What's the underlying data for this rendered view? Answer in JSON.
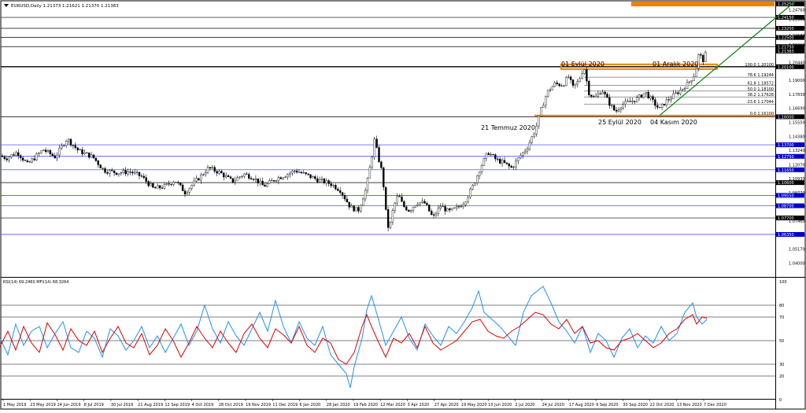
{
  "header": {
    "symbol_line": "EURUSD,Daily  1.21373 1.21621 1.21370 1.21383"
  },
  "indicator": {
    "title": "RSI(14) 69.2460  MFI(14) 68.3264"
  },
  "colors": {
    "rsi_line": "#e00000",
    "mfi_line": "#1e90ff",
    "trendline": "#008000",
    "zone": "#f08000",
    "blue_level": "#3030ff",
    "black_level": "#000000",
    "label_box_black": "#000000",
    "label_box_blue": "#0000cc"
  },
  "chart_data": {
    "type": "candlestick",
    "symbol": "EURUSD",
    "timeframe": "Daily",
    "ohlc_readout": {
      "open": 1.21373,
      "high": 1.21621,
      "low": 1.2137,
      "close": 1.21383
    },
    "x_ticks": [
      "1 May 2019",
      "23 May 2019",
      "14 Jun 2019",
      "8 Jul 2019",
      "30 Jul 2019",
      "21 Aug 2019",
      "12 Sep 2019",
      "4 Oct 2019",
      "28 Oct 2019",
      "19 Nov 2019",
      "11 Dec 2019",
      "6 Jan 2020",
      "28 Jan 2020",
      "19 Feb 2020",
      "12 Mar 2020",
      "3 Apr 2020",
      "27 Apr 2020",
      "19 May 2020",
      "10 Jun 2020",
      "2 Jul 2020",
      "24 Jul 2020",
      "17 Aug 2020",
      "9 Sep 2020",
      "30 Sep 2020",
      "22 Oct 2020",
      "13 Nov 2020",
      "7 Dec 2020"
    ],
    "y_axis_labels": [
      "1.24760",
      "1.23980",
      "1.23290",
      "1.22680",
      "1.21910",
      "1.20440",
      "1.19000",
      "1.17830",
      "1.16690",
      "1.15550",
      "1.14380",
      "1.13240",
      "1.12070",
      "1.10930",
      "1.09770",
      "1.08630",
      "1.07460",
      "1.06320",
      "1.05170",
      "1.04000",
      "1.02860"
    ],
    "price_path": [
      [
        0,
        1.128
      ],
      [
        8,
        1.126
      ],
      [
        22,
        1.131
      ],
      [
        35,
        1.121
      ],
      [
        55,
        1.133
      ],
      [
        70,
        1.127
      ],
      [
        85,
        1.142
      ],
      [
        100,
        1.132
      ],
      [
        118,
        1.127
      ],
      [
        132,
        1.116
      ],
      [
        150,
        1.114
      ],
      [
        165,
        1.115
      ],
      [
        180,
        1.111
      ],
      [
        195,
        1.101
      ],
      [
        210,
        1.103
      ],
      [
        222,
        1.108
      ],
      [
        235,
        1.098
      ],
      [
        250,
        1.108
      ],
      [
        265,
        1.118
      ],
      [
        280,
        1.114
      ],
      [
        295,
        1.107
      ],
      [
        310,
        1.113
      ],
      [
        322,
        1.11
      ],
      [
        335,
        1.103
      ],
      [
        350,
        1.109
      ],
      [
        362,
        1.112
      ],
      [
        375,
        1.116
      ],
      [
        390,
        1.112
      ],
      [
        405,
        1.108
      ],
      [
        420,
        1.105
      ],
      [
        432,
        1.1
      ],
      [
        445,
        1.086
      ],
      [
        455,
        1.083
      ],
      [
        465,
        1.101
      ],
      [
        472,
        1.125
      ],
      [
        476,
        1.142
      ],
      [
        480,
        1.128
      ],
      [
        486,
        1.113
      ],
      [
        490,
        1.083
      ],
      [
        494,
        1.066
      ],
      [
        500,
        1.086
      ],
      [
        506,
        1.096
      ],
      [
        512,
        1.087
      ],
      [
        520,
        1.083
      ],
      [
        530,
        1.09
      ],
      [
        540,
        1.089
      ],
      [
        550,
        1.077
      ],
      [
        560,
        1.087
      ],
      [
        570,
        1.082
      ],
      [
        580,
        1.085
      ],
      [
        590,
        1.09
      ],
      [
        600,
        1.102
      ],
      [
        610,
        1.118
      ],
      [
        620,
        1.131
      ],
      [
        630,
        1.125
      ],
      [
        640,
        1.122
      ],
      [
        650,
        1.118
      ],
      [
        660,
        1.127
      ],
      [
        670,
        1.135
      ],
      [
        680,
        1.149
      ],
      [
        688,
        1.167
      ],
      [
        695,
        1.18
      ],
      [
        705,
        1.187
      ],
      [
        715,
        1.186
      ],
      [
        722,
        1.193
      ],
      [
        728,
        1.184
      ],
      [
        735,
        1.189
      ],
      [
        742,
        1.201
      ],
      [
        748,
        1.18
      ],
      [
        755,
        1.175
      ],
      [
        765,
        1.182
      ],
      [
        775,
        1.17
      ],
      [
        782,
        1.164
      ],
      [
        790,
        1.17
      ],
      [
        800,
        1.172
      ],
      [
        810,
        1.175
      ],
      [
        820,
        1.18
      ],
      [
        830,
        1.172
      ],
      [
        838,
        1.166
      ],
      [
        845,
        1.172
      ],
      [
        855,
        1.177
      ],
      [
        865,
        1.182
      ],
      [
        875,
        1.188
      ],
      [
        883,
        1.195
      ],
      [
        888,
        1.212
      ],
      [
        893,
        1.206
      ],
      [
        898,
        1.214
      ]
    ],
    "horizontal_levels": [
      {
        "label": "1.25250",
        "price": 1.2525,
        "style": "zone"
      },
      {
        "label": "1.24150",
        "price": 1.2415,
        "style": "black"
      },
      {
        "label": "1.23250",
        "price": 1.2325,
        "style": "black"
      },
      {
        "label": "1.22500",
        "price": 1.225,
        "style": "black"
      },
      {
        "label": "1.21750",
        "price": 1.2175,
        "style": "black"
      },
      {
        "label": "1.20100",
        "price": 1.201,
        "style": "black_thick"
      },
      {
        "label": "1.16000",
        "price": 1.16,
        "style": "black"
      },
      {
        "label": "1.13700",
        "price": 1.137,
        "style": "blue"
      },
      {
        "label": "1.12750",
        "price": 1.1275,
        "style": "blue"
      },
      {
        "label": "1.11650",
        "price": 1.1165,
        "style": "blue"
      },
      {
        "label": "1.10600",
        "price": 1.106,
        "style": "black"
      },
      {
        "label": "1.09550",
        "price": 1.0955,
        "style": "blue"
      },
      {
        "label": "1.08700",
        "price": 1.087,
        "style": "blue"
      },
      {
        "label": "1.07700",
        "price": 1.077,
        "style": "black"
      },
      {
        "label": "1.06350",
        "price": 1.0635,
        "style": "blue"
      }
    ],
    "last_price_label": "1.21383",
    "fibonacci": {
      "high_price": 1.201,
      "low_price": 1.161,
      "levels": [
        {
          "label": "100.0 1.20100",
          "ratio": 1.0
        },
        {
          "label": "78.6 1.19244",
          "ratio": 0.786
        },
        {
          "label": "61.8 1.18572",
          "ratio": 0.618
        },
        {
          "label": "50.0 1.18100",
          "ratio": 0.5
        },
        {
          "label": "38.2 1.17628",
          "ratio": 0.382
        },
        {
          "label": "23.6 1.17044",
          "ratio": 0.236
        },
        {
          "label": "0.0 1.16100",
          "ratio": 0.0
        }
      ]
    },
    "annotations": [
      {
        "text": "01 Eylül 2020"
      },
      {
        "text": "01 Aralık 2020"
      },
      {
        "text": "21 Temmuz 2020"
      },
      {
        "text": "25 Eylül 2020"
      },
      {
        "text": "04 Kasım 2020"
      }
    ],
    "indicator": {
      "rsi_period": 14,
      "rsi_value": 69.246,
      "mfi_period": 14,
      "mfi_value": 68.3264,
      "scale_labels": [
        "100",
        "80",
        "70",
        "50",
        "30",
        "20",
        "0"
      ],
      "levels": [
        80,
        70,
        50,
        30,
        20
      ],
      "rsi_path": [
        [
          0,
          45
        ],
        [
          10,
          58
        ],
        [
          20,
          42
        ],
        [
          30,
          62
        ],
        [
          40,
          48
        ],
        [
          50,
          40
        ],
        [
          60,
          65
        ],
        [
          70,
          55
        ],
        [
          80,
          42
        ],
        [
          90,
          60
        ],
        [
          100,
          50
        ],
        [
          110,
          46
        ],
        [
          120,
          58
        ],
        [
          130,
          40
        ],
        [
          140,
          52
        ],
        [
          150,
          62
        ],
        [
          160,
          48
        ],
        [
          170,
          44
        ],
        [
          180,
          56
        ],
        [
          190,
          38
        ],
        [
          200,
          46
        ],
        [
          210,
          60
        ],
        [
          220,
          50
        ],
        [
          230,
          36
        ],
        [
          240,
          48
        ],
        [
          250,
          62
        ],
        [
          260,
          52
        ],
        [
          270,
          44
        ],
        [
          280,
          58
        ],
        [
          290,
          48
        ],
        [
          300,
          40
        ],
        [
          310,
          56
        ],
        [
          320,
          64
        ],
        [
          330,
          52
        ],
        [
          340,
          44
        ],
        [
          350,
          60
        ],
        [
          360,
          55
        ],
        [
          370,
          48
        ],
        [
          380,
          62
        ],
        [
          390,
          46
        ],
        [
          400,
          40
        ],
        [
          410,
          52
        ],
        [
          420,
          48
        ],
        [
          430,
          34
        ],
        [
          440,
          30
        ],
        [
          450,
          40
        ],
        [
          460,
          62
        ],
        [
          466,
          72
        ],
        [
          472,
          62
        ],
        [
          480,
          50
        ],
        [
          490,
          36
        ],
        [
          500,
          52
        ],
        [
          510,
          48
        ],
        [
          520,
          56
        ],
        [
          530,
          44
        ],
        [
          540,
          62
        ],
        [
          550,
          48
        ],
        [
          560,
          42
        ],
        [
          570,
          46
        ],
        [
          580,
          50
        ],
        [
          590,
          58
        ],
        [
          600,
          66
        ],
        [
          610,
          68
        ],
        [
          620,
          58
        ],
        [
          630,
          54
        ],
        [
          640,
          52
        ],
        [
          650,
          58
        ],
        [
          660,
          62
        ],
        [
          670,
          68
        ],
        [
          680,
          74
        ],
        [
          690,
          72
        ],
        [
          700,
          64
        ],
        [
          710,
          60
        ],
        [
          720,
          68
        ],
        [
          730,
          56
        ],
        [
          740,
          62
        ],
        [
          750,
          48
        ],
        [
          760,
          50
        ],
        [
          770,
          44
        ],
        [
          780,
          42
        ],
        [
          790,
          50
        ],
        [
          800,
          52
        ],
        [
          810,
          56
        ],
        [
          820,
          50
        ],
        [
          830,
          44
        ],
        [
          840,
          48
        ],
        [
          850,
          56
        ],
        [
          860,
          60
        ],
        [
          870,
          68
        ],
        [
          880,
          72
        ],
        [
          885,
          64
        ],
        [
          892,
          70
        ],
        [
          898,
          69
        ]
      ],
      "mfi_path": [
        [
          0,
          52
        ],
        [
          10,
          38
        ],
        [
          20,
          64
        ],
        [
          30,
          46
        ],
        [
          40,
          58
        ],
        [
          50,
          62
        ],
        [
          60,
          44
        ],
        [
          70,
          56
        ],
        [
          80,
          66
        ],
        [
          90,
          44
        ],
        [
          100,
          40
        ],
        [
          110,
          58
        ],
        [
          120,
          52
        ],
        [
          130,
          36
        ],
        [
          140,
          60
        ],
        [
          150,
          54
        ],
        [
          160,
          42
        ],
        [
          170,
          50
        ],
        [
          180,
          62
        ],
        [
          190,
          44
        ],
        [
          200,
          54
        ],
        [
          210,
          40
        ],
        [
          220,
          52
        ],
        [
          230,
          64
        ],
        [
          240,
          46
        ],
        [
          250,
          58
        ],
        [
          260,
          80
        ],
        [
          270,
          60
        ],
        [
          280,
          48
        ],
        [
          290,
          66
        ],
        [
          300,
          54
        ],
        [
          310,
          46
        ],
        [
          320,
          60
        ],
        [
          330,
          74
        ],
        [
          340,
          58
        ],
        [
          350,
          84
        ],
        [
          360,
          62
        ],
        [
          370,
          48
        ],
        [
          380,
          66
        ],
        [
          390,
          52
        ],
        [
          400,
          46
        ],
        [
          410,
          62
        ],
        [
          420,
          38
        ],
        [
          430,
          30
        ],
        [
          440,
          22
        ],
        [
          445,
          10
        ],
        [
          450,
          28
        ],
        [
          460,
          52
        ],
        [
          466,
          76
        ],
        [
          472,
          88
        ],
        [
          480,
          70
        ],
        [
          490,
          46
        ],
        [
          500,
          58
        ],
        [
          510,
          70
        ],
        [
          520,
          52
        ],
        [
          530,
          42
        ],
        [
          540,
          64
        ],
        [
          550,
          54
        ],
        [
          560,
          46
        ],
        [
          570,
          62
        ],
        [
          580,
          56
        ],
        [
          590,
          66
        ],
        [
          600,
          78
        ],
        [
          608,
          92
        ],
        [
          615,
          74
        ],
        [
          625,
          68
        ],
        [
          635,
          62
        ],
        [
          645,
          54
        ],
        [
          655,
          46
        ],
        [
          665,
          74
        ],
        [
          675,
          88
        ],
        [
          690,
          96
        ],
        [
          700,
          82
        ],
        [
          710,
          66
        ],
        [
          720,
          58
        ],
        [
          730,
          48
        ],
        [
          740,
          62
        ],
        [
          750,
          40
        ],
        [
          760,
          56
        ],
        [
          770,
          50
        ],
        [
          780,
          36
        ],
        [
          790,
          52
        ],
        [
          800,
          60
        ],
        [
          810,
          44
        ],
        [
          820,
          54
        ],
        [
          830,
          48
        ],
        [
          840,
          62
        ],
        [
          850,
          50
        ],
        [
          860,
          56
        ],
        [
          870,
          74
        ],
        [
          880,
          82
        ],
        [
          885,
          70
        ],
        [
          892,
          64
        ],
        [
          898,
          68
        ]
      ]
    }
  }
}
